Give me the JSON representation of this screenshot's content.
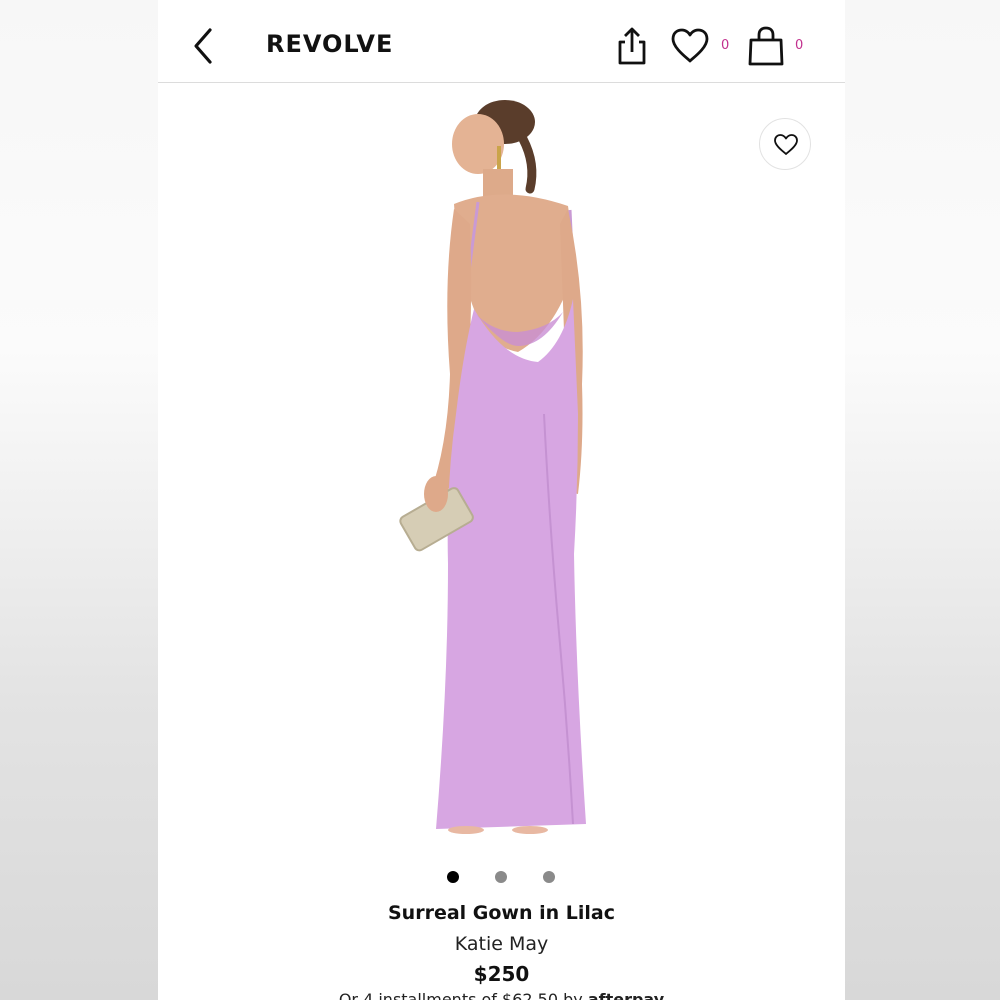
{
  "header": {
    "logo": "REVOLVE",
    "favorites_count": "0",
    "bag_count": "0",
    "icons": [
      "chevron-left-icon",
      "share-icon",
      "heart-icon",
      "shopping-bag-icon"
    ]
  },
  "image": {
    "description_icon": "product-photo",
    "favorite_icon": "heart-outline-icon",
    "carousel_dots": 3,
    "active_dot": 0
  },
  "product": {
    "title": "Surreal Gown in Lilac",
    "brand": "Katie May",
    "price": "$250",
    "installments_prefix": "Or 4 installments of $62.50 by",
    "installments_provider": "afterpay"
  },
  "colors": {
    "accent": "#c2308e",
    "gown": "#d7a6e2",
    "text": "#111111"
  }
}
